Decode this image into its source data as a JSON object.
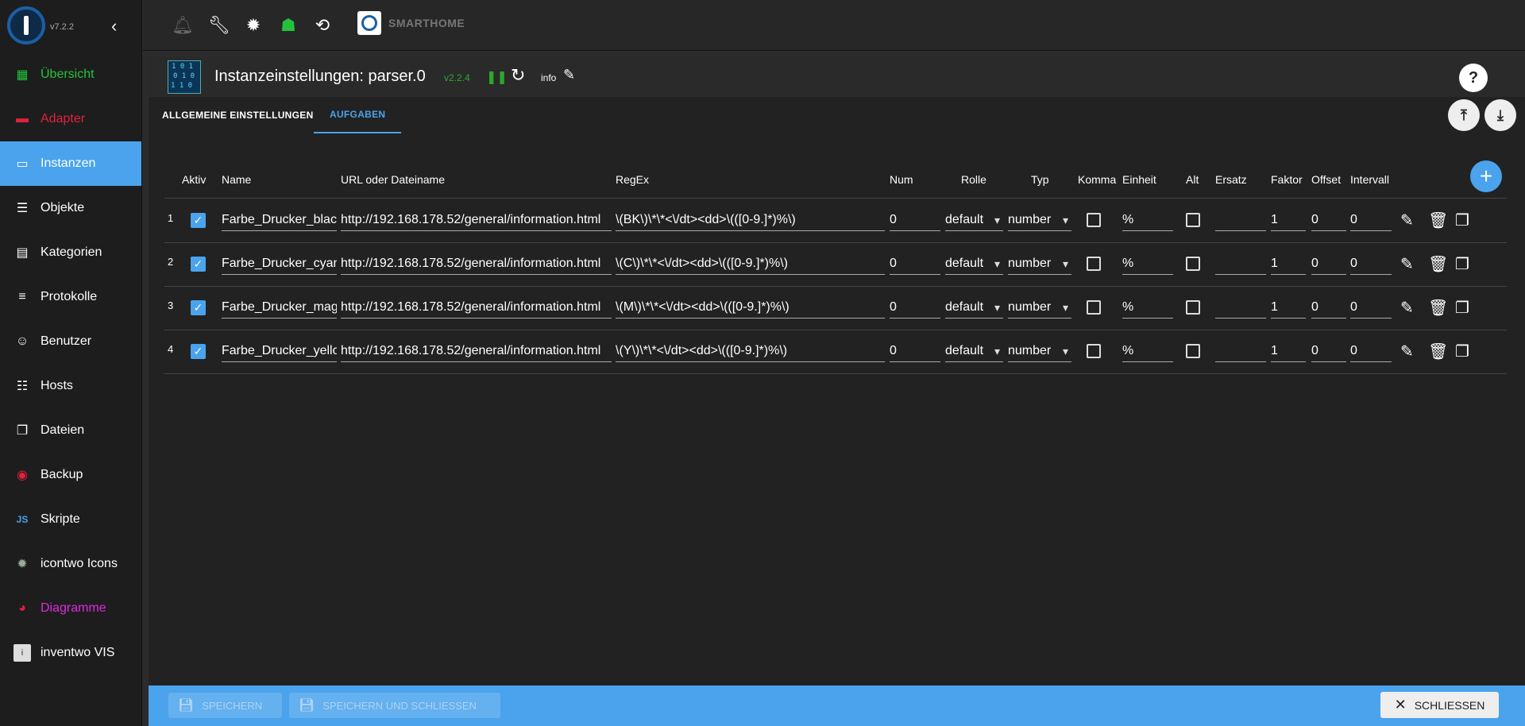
{
  "sidebar": {
    "version": "v7.2.2",
    "items": [
      {
        "label": "Übersicht",
        "icon": "grid-icon"
      },
      {
        "label": "Adapter",
        "icon": "store-icon"
      },
      {
        "label": "Instanzen",
        "icon": "instances-icon"
      },
      {
        "label": "Objekte",
        "icon": "list-icon"
      },
      {
        "label": "Kategorien",
        "icon": "card-icon"
      },
      {
        "label": "Protokolle",
        "icon": "log-icon"
      },
      {
        "label": "Benutzer",
        "icon": "user-icon"
      },
      {
        "label": "Hosts",
        "icon": "hosts-icon"
      },
      {
        "label": "Dateien",
        "icon": "files-icon"
      },
      {
        "label": "Backup",
        "icon": "backup-icon"
      },
      {
        "label": "Skripte",
        "icon": "js-icon"
      },
      {
        "label": "icontwo Icons",
        "icon": "icontwo-icon"
      },
      {
        "label": "Diagramme",
        "icon": "diagram-icon"
      },
      {
        "label": "inventwo VIS",
        "icon": "inventwo-icon"
      }
    ],
    "colors": {
      "green": "#22c33a",
      "red": "#e0223b",
      "active": "#4aa3ec",
      "magenta": "#e02ae0"
    }
  },
  "topbar": {
    "title": "SMARTHOME"
  },
  "header": {
    "title": "Instanzeinstellungen: parser.0",
    "version": "v2.2.4",
    "info": "info"
  },
  "tabs": [
    {
      "label": "ALLGEMEINE EINSTELLUNGEN"
    },
    {
      "label": "AUFGABEN"
    }
  ],
  "table": {
    "columns": [
      "Aktiv",
      "Name",
      "URL oder Dateiname",
      "RegEx",
      "Num",
      "Rolle",
      "Typ",
      "Komma",
      "Einheit",
      "Alt",
      "Ersatz",
      "Faktor",
      "Offset",
      "Intervall"
    ],
    "rows": [
      {
        "index": "1",
        "name": "Farbe_Drucker_black",
        "url": "http://192.168.178.52/general/information.html",
        "regex": "\\(BK\\)\\*\\*<\\/dt><dd>\\(([0-9.]*)%\\)",
        "num": "0",
        "role": "default",
        "type": "number",
        "unit": "%",
        "ersatz": "",
        "factor": "1",
        "offset": "0",
        "interval": "0"
      },
      {
        "index": "2",
        "name": "Farbe_Drucker_cyan",
        "url": "http://192.168.178.52/general/information.html",
        "regex": "\\(C\\)\\*\\*<\\/dt><dd>\\(([0-9.]*)%\\)",
        "num": "0",
        "role": "default",
        "type": "number",
        "unit": "%",
        "ersatz": "",
        "factor": "1",
        "offset": "0",
        "interval": "0"
      },
      {
        "index": "3",
        "name": "Farbe_Drucker_magenta",
        "url": "http://192.168.178.52/general/information.html",
        "regex": "\\(M\\)\\*\\*<\\/dt><dd>\\(([0-9.]*)%\\)",
        "num": "0",
        "role": "default",
        "type": "number",
        "unit": "%",
        "ersatz": "",
        "factor": "1",
        "offset": "0",
        "interval": "0"
      },
      {
        "index": "4",
        "name": "Farbe_Drucker_yellow",
        "url": "http://192.168.178.52/general/information.html",
        "regex": "\\(Y\\)\\*\\*<\\/dt><dd>\\(([0-9.]*)%\\)",
        "num": "0",
        "role": "default",
        "type": "number",
        "unit": "%",
        "ersatz": "",
        "factor": "1",
        "offset": "0",
        "interval": "0"
      }
    ]
  },
  "footer": {
    "save": "SPEICHERN",
    "save_close": "SPEICHERN UND SCHLIESSEN",
    "close": "SCHLIESSEN"
  }
}
